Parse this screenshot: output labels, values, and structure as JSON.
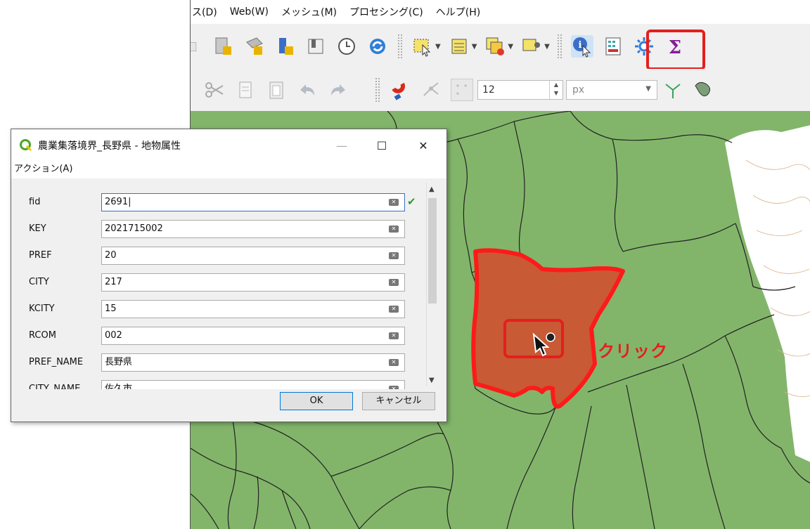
{
  "menubar": {
    "items": [
      "ス(D)",
      "Web(W)",
      "メッシュ(M)",
      "プロセシング(C)",
      "ヘルプ(H)"
    ]
  },
  "toolbar": {
    "snap_tolerance_value": "12",
    "snap_unit": "px",
    "icons": [
      "layout-icon",
      "manager-icon",
      "temporal-icon",
      "refresh-icon",
      "select-feature-icon",
      "attribute-table-icon",
      "deselect-icon",
      "select-location-icon",
      "identify-features-icon",
      "field-calculator-icon",
      "settings-icon",
      "sigma-icon",
      "cut-icon",
      "copy-icon",
      "paste-icon",
      "undo-icon",
      "redo-icon",
      "magnet-icon",
      "vertex-tool-icon",
      "topology-icon",
      "trace-icon"
    ]
  },
  "map": {
    "annotation": "クリック",
    "colors": {
      "polygon_fill": "#82b56a",
      "polygon_stroke": "#222222",
      "selected_fill": "#c85a35",
      "selected_stroke": "#ff1a1a",
      "annotation": "#e51e1e"
    }
  },
  "dialog": {
    "title": "農業集落境界_長野県 - 地物属性",
    "menu": "アクション(A)",
    "fields": [
      {
        "label": "fid",
        "value": "2691|"
      },
      {
        "label": "KEY",
        "value": "2021715002"
      },
      {
        "label": "PREF",
        "value": "20"
      },
      {
        "label": "CITY",
        "value": "217"
      },
      {
        "label": "KCITY",
        "value": "15"
      },
      {
        "label": "RCOM",
        "value": "002"
      },
      {
        "label": "PREF_NAME",
        "value": "長野県"
      },
      {
        "label": "CITY_NAME",
        "value": "佐久市"
      }
    ],
    "ok_label": "OK",
    "cancel_label": "キャンセル"
  }
}
